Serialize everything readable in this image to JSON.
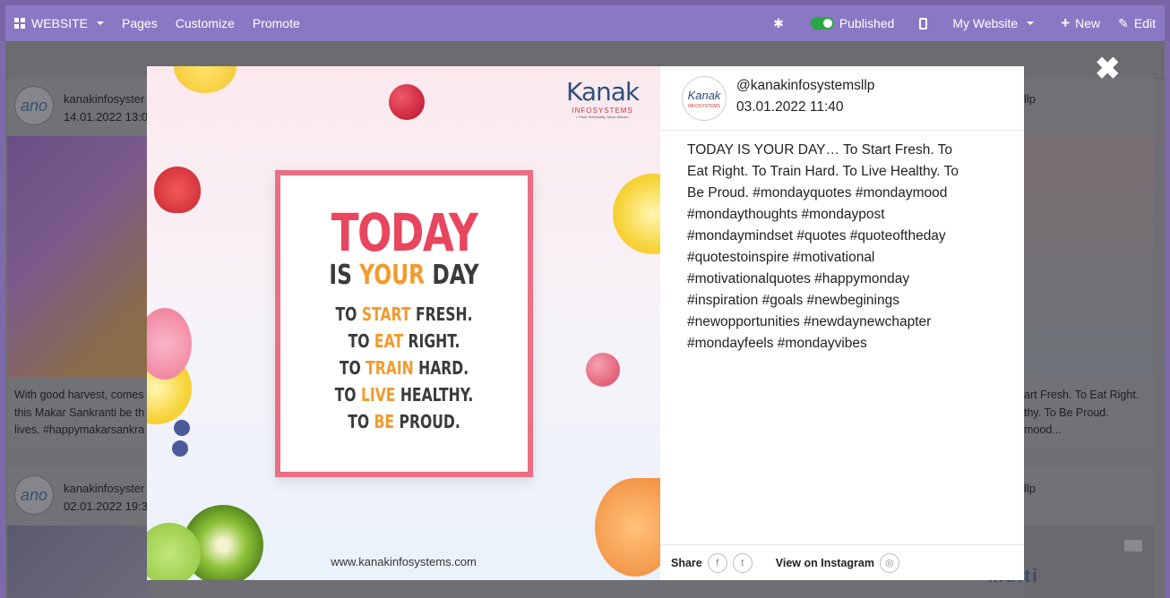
{
  "topbar": {
    "website_label": "WEBSITE",
    "pages": "Pages",
    "customize": "Customize",
    "promote": "Promote",
    "published": "Published",
    "my_website": "My Website",
    "new": "New",
    "edit": "Edit"
  },
  "background": {
    "cards": [
      {
        "handle": "kanakinfosyster",
        "date": "14.01.2022 13:0",
        "text": "With good harvest, comes\nthis Makar Sankranti be th\nlives. #happymakarsankra"
      },
      {
        "handle": "kanakinfosyster",
        "date": "02.01.2022 19:3",
        "text": ""
      }
    ],
    "right_cards": [
      {
        "handle": "llp",
        "text": "art Fresh. To Eat Right.\nthy. To Be Proud.\nmood..."
      },
      {
        "handle": "llp"
      }
    ],
    "logo_text": "ano",
    "right_bottom_text": "Multi"
  },
  "modal": {
    "handle": "@kanakinfosystemsllp",
    "date": "03.01.2022 11:40",
    "caption": "TODAY IS YOUR DAY… To Start Fresh. To Eat Right. To Train Hard. To Live Healthy. To Be Proud. #mondayquotes #mondaymood #mondaythoughts #mondaypost #mondaymindset #quotes #quoteoftheday #quotestoinspire #motivational #motivationalquotes #happymonday #inspiration #goals #newbeginings #newopportunities #newdaynewchapter #mondayfeels #mondayvibes",
    "share_label": "Share",
    "view_label": "View on Instagram",
    "logo_letter": "Kanak",
    "logo_sub": "INFOSYSTEMS",
    "close_symbol": "✖"
  },
  "poster": {
    "brand": "Kanak",
    "brand_sub": "INFOSYSTEMS",
    "brand_tag": "• Think Technically, Move Ahead •",
    "l1": "TODAY",
    "l2_a": "IS ",
    "l2_b": "YOUR",
    "l2_c": " DAY",
    "rows": [
      {
        "a": "TO ",
        "b": "START",
        "c": " FRESH."
      },
      {
        "a": "TO ",
        "b": "EAT",
        "c": " RIGHT."
      },
      {
        "a": "TO ",
        "b": "TRAIN",
        "c": " HARD."
      },
      {
        "a": "TO ",
        "b": "LIVE",
        "c": " HEALTHY."
      },
      {
        "a": "TO ",
        "b": "BE",
        "c": " PROUD."
      }
    ],
    "url": "www.kanakinfosystems.com"
  },
  "colors": {
    "topbar": "#8a78c4",
    "poster_border": "#ec6f84",
    "poster_title": "#e8455e",
    "accent_orange": "#f39a2b",
    "toggle_on": "#28a745"
  }
}
